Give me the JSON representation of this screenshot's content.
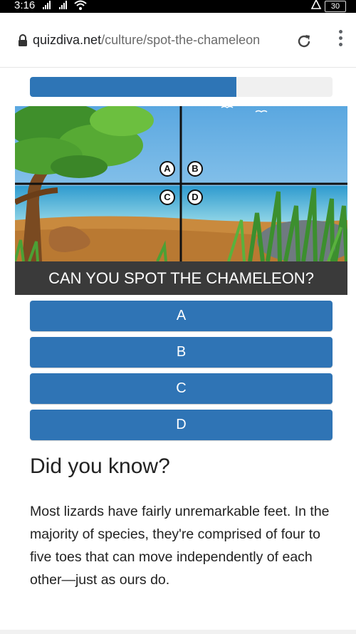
{
  "status_bar": {
    "time": "3:16",
    "battery": "30"
  },
  "browser": {
    "url_domain": "quizdiva.net",
    "url_path": "/culture/spot-the-chameleon",
    "icons": [
      "lock-icon",
      "reload-icon",
      "more-vert-icon"
    ]
  },
  "quiz": {
    "progress_fraction": 0.682,
    "accent_color": "#2f74b5",
    "markers": [
      "A",
      "B",
      "C",
      "D"
    ],
    "question": "CAN YOU SPOT THE CHAMELEON?",
    "answers": [
      "A",
      "B",
      "C",
      "D"
    ]
  },
  "fact": {
    "title": "Did you know?",
    "body": "Most lizards have fairly unremarkable feet. In the majority of species, they're comprised of four to five toes that can move independently of each other—just as ours do."
  }
}
